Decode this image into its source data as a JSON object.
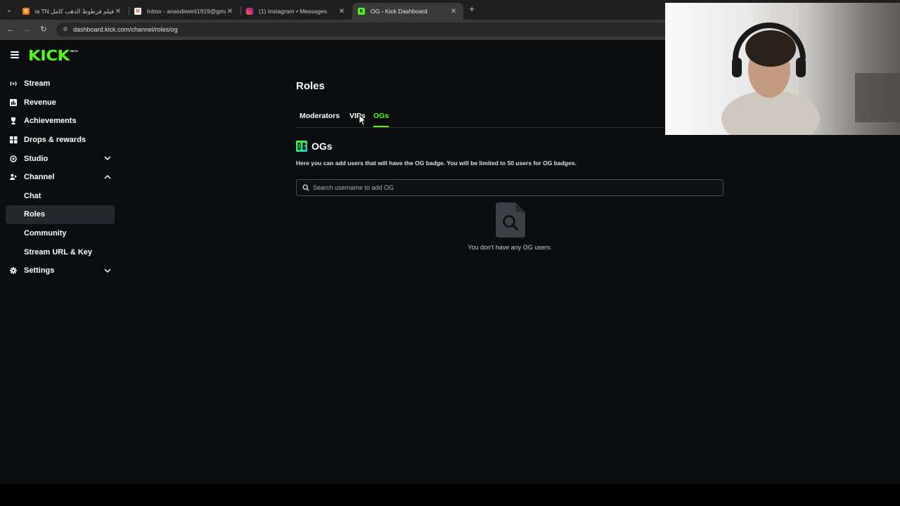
{
  "browser": {
    "tabs": [
      {
        "title": "فيلم فرطوط الذهب كامل ima TN",
        "favicon": "blogger-icon",
        "favicon_color": "#f57c00"
      },
      {
        "title": "Inbox - anasdiwerii1919@gmail",
        "favicon": "gmail-icon",
        "favicon_color": "#ea4335"
      },
      {
        "title": "(1) Instagram • Messages",
        "favicon": "instagram-icon",
        "favicon_color": "#e1306c"
      },
      {
        "title": "OG - Kick Dashboard",
        "favicon": "kick-icon",
        "favicon_color": "#53fc18",
        "active": true
      }
    ],
    "url": "dashboard.kick.com/channel/roles/og"
  },
  "brand": {
    "name": "KICK",
    "badge": "BETA",
    "accent": "#53fc18"
  },
  "sidebar": {
    "items": [
      {
        "label": "Stream",
        "icon": "broadcast-icon"
      },
      {
        "label": "Revenue",
        "icon": "chart-icon"
      },
      {
        "label": "Achievements",
        "icon": "trophy-icon"
      },
      {
        "label": "Drops & rewards",
        "icon": "gift-icon"
      },
      {
        "label": "Studio",
        "icon": "studio-icon",
        "expandable": true,
        "expanded": false
      },
      {
        "label": "Channel",
        "icon": "channel-icon",
        "expandable": true,
        "expanded": true
      },
      {
        "label": "Chat",
        "sub": true
      },
      {
        "label": "Roles",
        "sub": true,
        "selected": true
      },
      {
        "label": "Community",
        "sub": true
      },
      {
        "label": "Stream URL & Key",
        "sub": true
      },
      {
        "label": "Settings",
        "icon": "gear-icon",
        "expandable": true,
        "expanded": false
      }
    ]
  },
  "main": {
    "title": "Roles",
    "tabs": [
      {
        "label": "Moderators"
      },
      {
        "label": "VIPs"
      },
      {
        "label": "OGs",
        "active": true
      }
    ],
    "section_title": "OGs",
    "description": "Here you can add users that will have the OG badge. You will be limited to 50 users for OG badges.",
    "search_placeholder": "Search username to add OG",
    "empty_text": "You don't have any OG users."
  }
}
